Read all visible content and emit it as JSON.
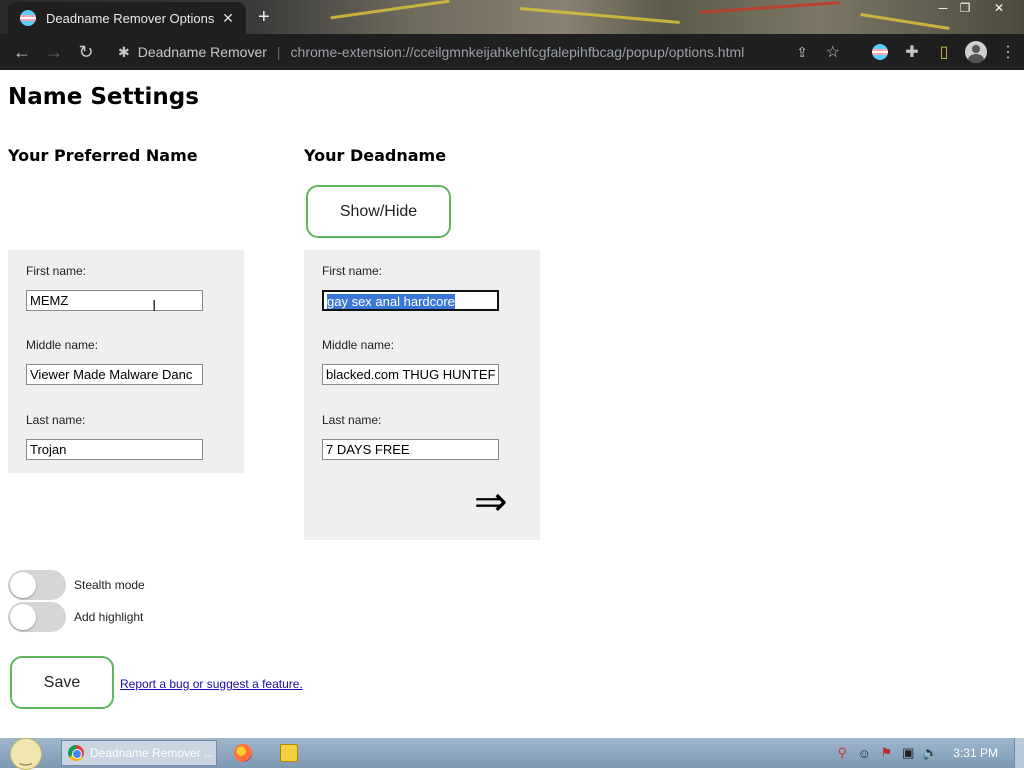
{
  "browser": {
    "tab_title": "Deadname Remover Options",
    "tab_close": "✕",
    "new_tab": "+",
    "site_name": "Deadname Remover",
    "url": "chrome-extension://cceilgmnkeijahkehfcgfalepihfbcag/popup/options.html"
  },
  "page": {
    "heading": "Name Settings",
    "preferred": {
      "heading": "Your Preferred Name",
      "first_label": "First name:",
      "first_value": "MEMZ",
      "middle_label": "Middle name:",
      "middle_value": "Viewer Made Malware Danc",
      "last_label": "Last name:",
      "last_value": "Trojan"
    },
    "deadname": {
      "heading": "Your Deadname",
      "show_hide_label": "Show/Hide",
      "first_label": "First name:",
      "first_value": "gay sex anal hardcore",
      "middle_label": "Middle name:",
      "middle_value": "blacked.com THUG HUNTEF",
      "last_label": "Last name:",
      "last_value": "7 DAYS FREE",
      "arrow": "⇒"
    },
    "toggles": [
      {
        "label": "Stealth mode",
        "on": false
      },
      {
        "label": "Add highlight",
        "on": false
      }
    ],
    "save_label": "Save",
    "report_link": "Report a bug or suggest a feature."
  },
  "taskbar": {
    "task_label": "Deadname Remover ...",
    "clock": "3:31 PM"
  },
  "colors": {
    "button_border": "#5fb65f",
    "panel_bg": "#efefef",
    "selection": "#3a78d8",
    "taskbar": "#8fa7bf"
  }
}
